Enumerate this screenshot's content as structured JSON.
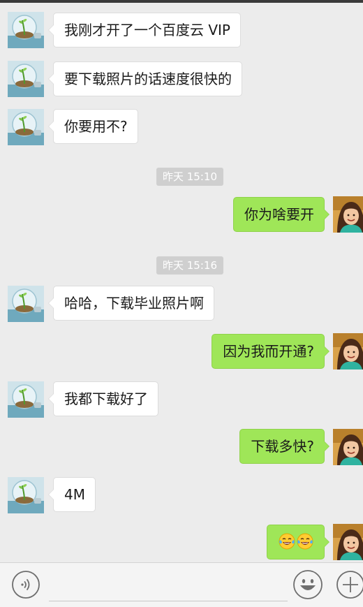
{
  "messages": [
    {
      "side": "in",
      "text": "我刚才开了一个百度云 VIP"
    },
    {
      "side": "in",
      "text": "要下载照片的话速度很快的"
    },
    {
      "side": "in",
      "text": "你要用不?"
    },
    {
      "time": "昨天 15:10"
    },
    {
      "side": "out",
      "text": "你为啥要开"
    },
    {
      "time": "昨天 15:16"
    },
    {
      "side": "in",
      "text": "哈哈，下载毕业照片啊"
    },
    {
      "side": "out",
      "text": "因为我而开通?"
    },
    {
      "side": "in",
      "text": "我都下载好了"
    },
    {
      "side": "out",
      "text": "下载多快?"
    },
    {
      "side": "in",
      "text": "4M"
    },
    {
      "side": "out",
      "emoji": [
        "tears-of-joy-emoji",
        "tears-of-joy-emoji"
      ]
    }
  ],
  "icons": {
    "contact_avatar": "lightbulb-sprout-avatar",
    "self_avatar": "girl-photo-avatar",
    "voice": "voice-icon",
    "emoji": "smiley-face-icon",
    "more": "plus-icon"
  },
  "colors": {
    "background": "#ececec",
    "bubble_in": "#ffffff",
    "bubble_out": "#9fe658",
    "timestamp_bg": "#cfcfcf"
  }
}
